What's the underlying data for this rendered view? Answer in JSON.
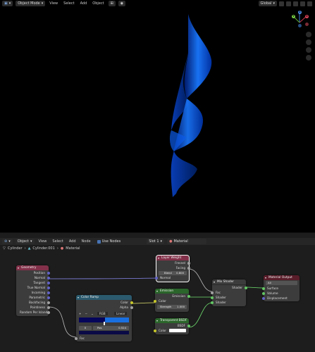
{
  "viewport_header": {
    "mode": "Object Mode",
    "menus": [
      "View",
      "Select",
      "Add",
      "Object"
    ],
    "transform": "Global"
  },
  "gizmo": {
    "x": "X",
    "y": "Y",
    "z": "Z"
  },
  "node_header": {
    "editor_type": "Object",
    "menus": [
      "View",
      "Select",
      "Add",
      "Node"
    ],
    "use_nodes": "Use Nodes",
    "slot": "Slot 1",
    "material": "Material"
  },
  "breadcrumb": {
    "object": "Cylinder",
    "mesh": "Cylinder.001",
    "material": "Material"
  },
  "nodes": {
    "geometry": {
      "title": "Geometry",
      "outputs": [
        "Position",
        "Normal",
        "Tangent",
        "True Normal",
        "Incoming",
        "Parametric",
        "Backfacing",
        "Pointiness",
        "Random Per Island"
      ]
    },
    "layer_weight": {
      "title": "Layer Weight",
      "outputs": [
        "Fresnel",
        "Facing"
      ],
      "blend_label": "Blend",
      "blend_value": "0.800",
      "input": "Normal"
    },
    "color_ramp": {
      "title": "Color Ramp",
      "outputs": [
        "Color",
        "Alpha"
      ],
      "mode": "RGB",
      "interp": "Linear",
      "index": "0",
      "pos_label": "Pos",
      "pos_value": "0.524",
      "input": "Fac"
    },
    "emission": {
      "title": "Emission",
      "output": "Emission",
      "input_color": "Color",
      "strength_label": "Strength",
      "strength_value": "1.000"
    },
    "transparent": {
      "title": "Transparent BSDF",
      "output": "BSDF",
      "input_color": "Color"
    },
    "mix_shader": {
      "title": "Mix Shader",
      "output": "Shader",
      "inputs": [
        "Fac",
        "Shader",
        "Shader"
      ]
    },
    "material_output": {
      "title": "Material Output",
      "target": "All",
      "inputs": [
        "Surface",
        "Volume",
        "Displacement"
      ]
    }
  },
  "colors": {
    "ramp_left": "#05055a",
    "ramp_right": "#1a6fe0",
    "geometry_header": "#83314a",
    "emission_header": "#2b652b",
    "mix_header": "#3c3c3c",
    "material_output_header": "#5a1d2a",
    "color_ramp_header": "#2b5a6e"
  }
}
